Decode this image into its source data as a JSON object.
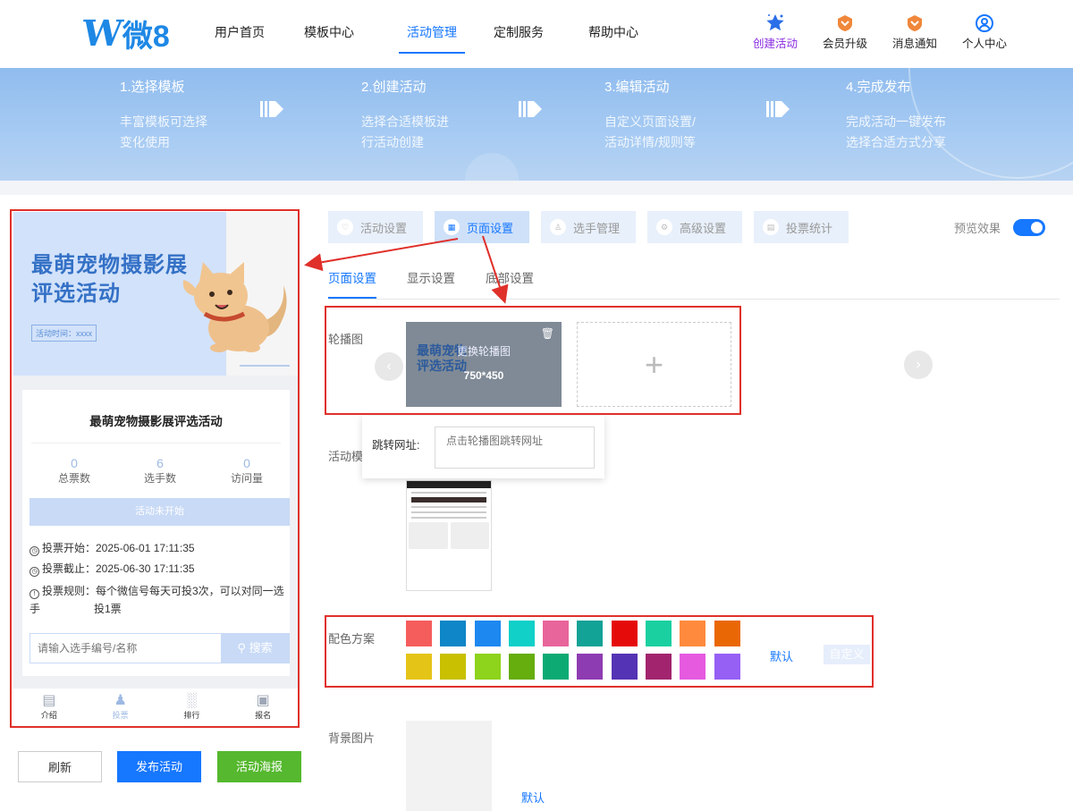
{
  "header": {
    "logo_w": "W",
    "logo_text": "微8",
    "nav": [
      "用户首页",
      "模板中心",
      "活动管理",
      "定制服务",
      "帮助中心"
    ],
    "active_nav": "活动管理",
    "icons": [
      {
        "label": "创建活动",
        "icon": "star-icon"
      },
      {
        "label": "会员升级",
        "icon": "vip-badge-icon"
      },
      {
        "label": "消息通知",
        "icon": "notification-badge-icon"
      },
      {
        "label": "个人中心",
        "icon": "user-icon"
      }
    ]
  },
  "banner": {
    "steps": [
      {
        "title": "1.选择模板",
        "desc1": "丰富模板可选择",
        "desc2": "变化使用"
      },
      {
        "title": "2.创建活动",
        "desc1": "选择合适模板进",
        "desc2": "行活动创建"
      },
      {
        "title": "3.编辑活动",
        "desc1": "自定义页面设置/",
        "desc2": "活动详情/规则等"
      },
      {
        "title": "4.完成发布",
        "desc1": "完成活动一键发布",
        "desc2": "选择合适方式分享"
      }
    ]
  },
  "preview": {
    "banner_title_line1": "最萌宠物摄影展",
    "banner_title_line2": "评选活动",
    "banner_time": "活动时间：xxxx",
    "card_title": "最萌宠物摄影展评选活动",
    "stats": [
      {
        "value": "0",
        "label": "总票数"
      },
      {
        "value": "6",
        "label": "选手数"
      },
      {
        "value": "0",
        "label": "访问量"
      }
    ],
    "status_button": "活动未开始",
    "vote_start": "投票开始：2025-06-01 17:11:35",
    "vote_end": "投票截止：2025-06-30 17:11:35",
    "vote_rule_line1": "投票规则：每个微信号每天可投3次，可以对同一选手",
    "vote_rule_line2": "投1票",
    "search_placeholder": "请输入选手编号/名称",
    "search_button": "搜索",
    "tabs": [
      {
        "label": "介绍",
        "icon": "intro-icon"
      },
      {
        "label": "投票",
        "icon": "vote-person-icon"
      },
      {
        "label": "排行",
        "icon": "ranking-icon"
      },
      {
        "label": "报名",
        "icon": "signup-icon"
      }
    ],
    "active_tab": "投票"
  },
  "bottom_buttons": {
    "refresh": "刷新",
    "publish": "发布活动",
    "poster": "活动海报"
  },
  "panel": {
    "top_tabs": [
      "活动设置",
      "页面设置",
      "选手管理",
      "高级设置",
      "投票统计"
    ],
    "active_top_tab": "页面设置",
    "preview_label": "预览效果",
    "preview_on": true,
    "sub_tabs": [
      "页面设置",
      "显示设置",
      "底部设置"
    ],
    "active_sub_tab": "页面设置",
    "carousel_label": "轮播图",
    "carousel_thumb_title_line1": "最萌宠物",
    "carousel_thumb_title_line2": "评选活动",
    "carousel_replace_text": "更换轮播图",
    "carousel_size": "750*450",
    "carousel_add": "+",
    "jump_label": "跳转网址:",
    "jump_placeholder": "点击轮播图跳转网址",
    "template_label": "活动模",
    "color_label": "配色方案",
    "colors": [
      "#f55c5c",
      "#0e86c7",
      "#1d88f0",
      "#10d0c8",
      "#e8659b",
      "#12a296",
      "#e50b0b",
      "#1ad0a0",
      "#ff8a3d",
      "#e96805",
      "#e5c418",
      "#c8c000",
      "#8ed31c",
      "#66ad0e",
      "#0dab73",
      "#8e3cb2",
      "#5433b4",
      "#a2246e",
      "#e55adf",
      "#9660f5"
    ],
    "color_default": "默认",
    "color_custom": "自定义",
    "bg_label": "背景图片",
    "bg_default": "默认"
  }
}
